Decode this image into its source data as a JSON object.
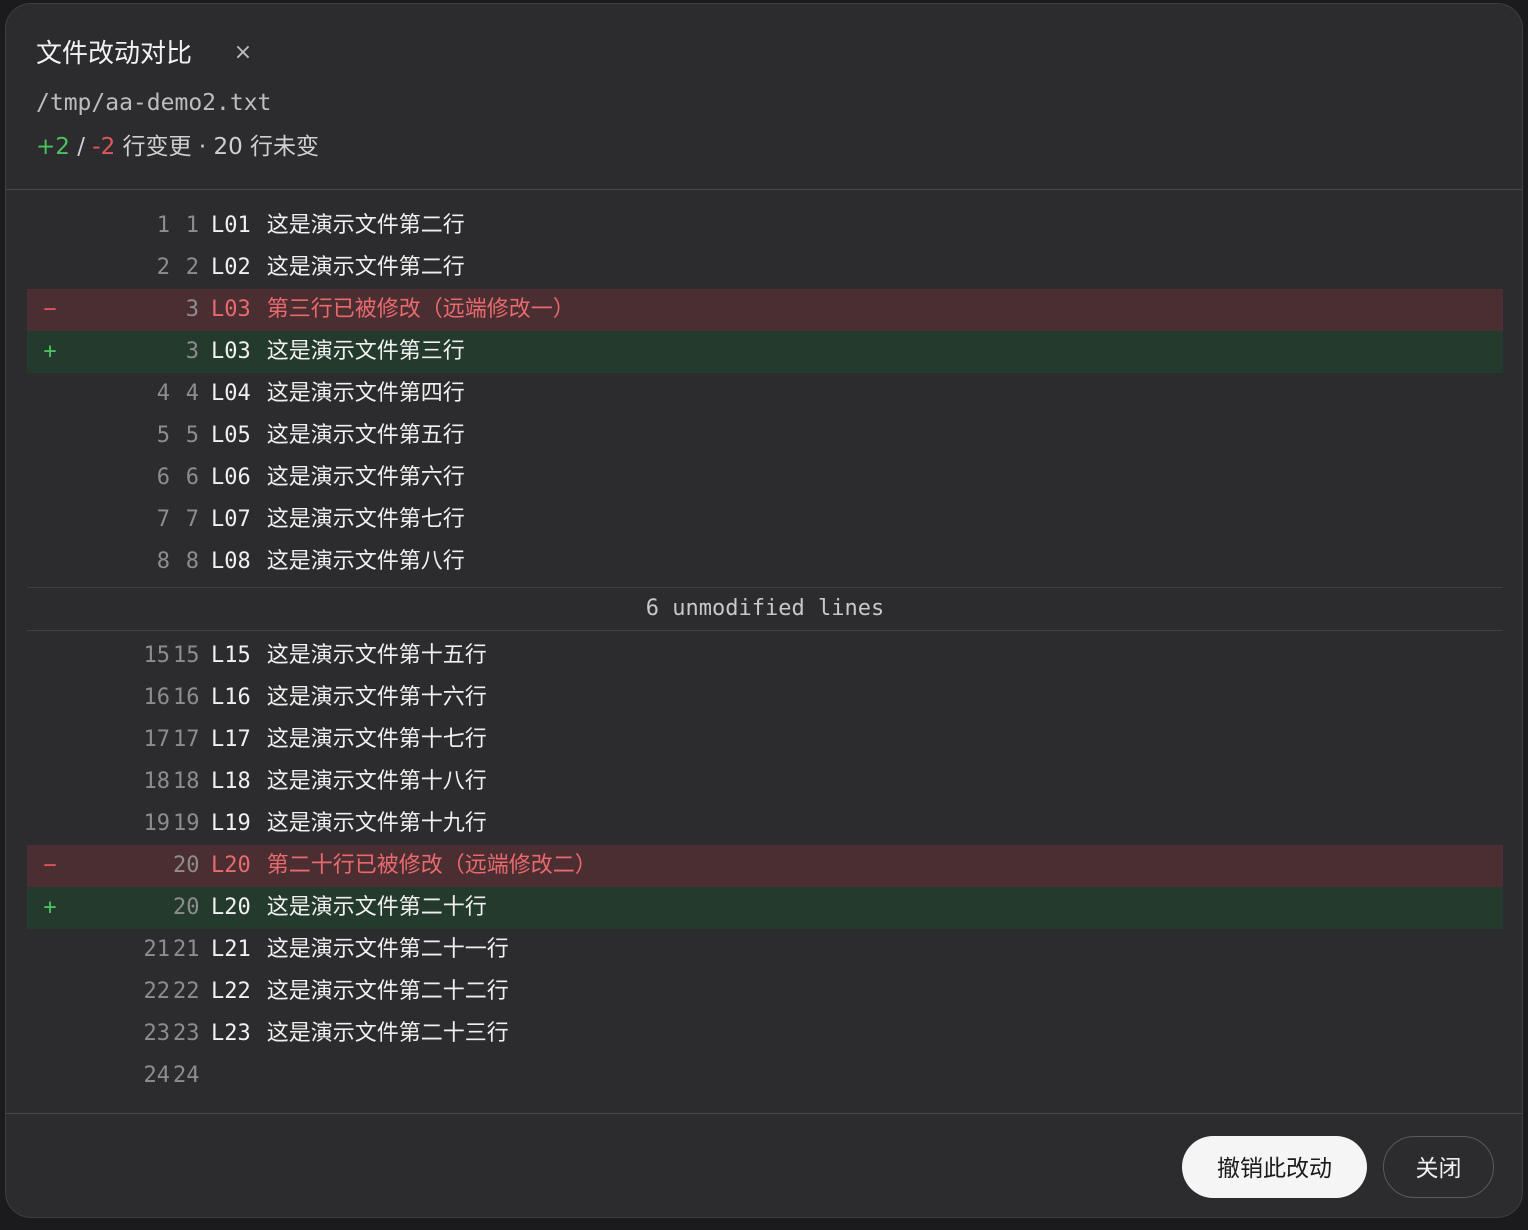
{
  "dialog": {
    "title": "文件改动对比",
    "close_icon": "×",
    "file_path": "/tmp/aa-demo2.txt",
    "summary": {
      "added": "+2",
      "separator": " / ",
      "removed": "-2",
      "changed_label": " 行变更 · ",
      "unchanged_count": "20",
      "unchanged_label": " 行未变"
    }
  },
  "diff_rows_a": [
    {
      "type": "ctx",
      "sign": "",
      "old": "1",
      "new": "1",
      "key": "L01",
      "text": "这是演示文件第二行"
    },
    {
      "type": "ctx",
      "sign": "",
      "old": "2",
      "new": "2",
      "key": "L02",
      "text": "这是演示文件第二行"
    },
    {
      "type": "del",
      "sign": "−",
      "old": "",
      "new": "3",
      "key": "L03",
      "text": "第三行已被修改（远端修改一）"
    },
    {
      "type": "add",
      "sign": "+",
      "old": "",
      "new": "3",
      "key": "L03",
      "text": "这是演示文件第三行"
    },
    {
      "type": "ctx",
      "sign": "",
      "old": "4",
      "new": "4",
      "key": "L04",
      "text": "这是演示文件第四行"
    },
    {
      "type": "ctx",
      "sign": "",
      "old": "5",
      "new": "5",
      "key": "L05",
      "text": "这是演示文件第五行"
    },
    {
      "type": "ctx",
      "sign": "",
      "old": "6",
      "new": "6",
      "key": "L06",
      "text": "这是演示文件第六行"
    },
    {
      "type": "ctx",
      "sign": "",
      "old": "7",
      "new": "7",
      "key": "L07",
      "text": "这是演示文件第七行"
    },
    {
      "type": "ctx",
      "sign": "",
      "old": "8",
      "new": "8",
      "key": "L08",
      "text": "这是演示文件第八行"
    }
  ],
  "fold_label": "6 unmodified lines",
  "diff_rows_b": [
    {
      "type": "ctx",
      "sign": "",
      "old": "15",
      "new": "15",
      "key": "L15",
      "text": "这是演示文件第十五行"
    },
    {
      "type": "ctx",
      "sign": "",
      "old": "16",
      "new": "16",
      "key": "L16",
      "text": "这是演示文件第十六行"
    },
    {
      "type": "ctx",
      "sign": "",
      "old": "17",
      "new": "17",
      "key": "L17",
      "text": "这是演示文件第十七行"
    },
    {
      "type": "ctx",
      "sign": "",
      "old": "18",
      "new": "18",
      "key": "L18",
      "text": "这是演示文件第十八行"
    },
    {
      "type": "ctx",
      "sign": "",
      "old": "19",
      "new": "19",
      "key": "L19",
      "text": "这是演示文件第十九行"
    },
    {
      "type": "del",
      "sign": "−",
      "old": "",
      "new": "20",
      "key": "L20",
      "text": "第二十行已被修改（远端修改二）"
    },
    {
      "type": "add",
      "sign": "+",
      "old": "",
      "new": "20",
      "key": "L20",
      "text": "这是演示文件第二十行"
    },
    {
      "type": "ctx",
      "sign": "",
      "old": "21",
      "new": "21",
      "key": "L21",
      "text": "这是演示文件第二十一行"
    },
    {
      "type": "ctx",
      "sign": "",
      "old": "22",
      "new": "22",
      "key": "L22",
      "text": "这是演示文件第二十二行"
    },
    {
      "type": "ctx",
      "sign": "",
      "old": "23",
      "new": "23",
      "key": "L23",
      "text": "这是演示文件第二十三行"
    },
    {
      "type": "ctx",
      "sign": "",
      "old": "24",
      "new": "24",
      "key": "",
      "text": ""
    }
  ],
  "buttons": {
    "revert_label": "撤销此改动",
    "close_label": "关闭"
  },
  "colors": {
    "added": "#4cc25e",
    "removed": "#e2555a",
    "added_row_bg": "#243a2c",
    "removed_row_bg": "#4a2e31",
    "dialog_bg": "#2c2c2e"
  }
}
